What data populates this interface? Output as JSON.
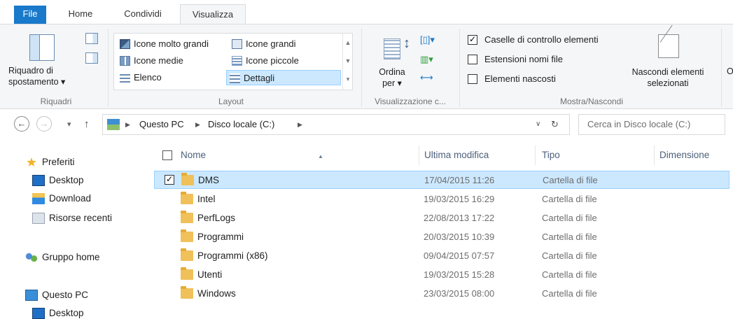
{
  "ribbon_tabs": {
    "file": "File",
    "home": "Home",
    "share": "Condividi",
    "view": "Visualizza"
  },
  "ribbon": {
    "panes": {
      "nav_pane_label_line1": "Riquadro di",
      "nav_pane_label_line2": "spostamento ▾",
      "group_label": "Riquadri"
    },
    "layout": {
      "items": [
        "Icone molto grandi",
        "Icone grandi",
        "Icone medie",
        "Icone piccole",
        "Elenco",
        "Dettagli"
      ],
      "selected": "Dettagli",
      "group_label": "Layout"
    },
    "current_view": {
      "sort_line1": "Ordina",
      "sort_line2": "per ▾",
      "group_label": "Visualizzazione c..."
    },
    "show_hide": {
      "checkboxes": [
        {
          "label": "Caselle di controllo elementi",
          "checked": true
        },
        {
          "label": "Estensioni nomi file",
          "checked": false
        },
        {
          "label": "Elementi nascosti",
          "checked": false
        }
      ],
      "hide_selected_line1": "Nascondi elementi",
      "hide_selected_line2": "selezionati",
      "group_label": "Mostra/Nascondi",
      "cutoff_text": "O"
    }
  },
  "address_bar": {
    "breadcrumbs": [
      "Questo PC",
      "Disco locale (C:)"
    ],
    "search_placeholder": "Cerca in Disco locale (C:)"
  },
  "nav_pane": {
    "favorites": "Preferiti",
    "favorites_items": [
      "Desktop",
      "Download",
      "Risorse recenti"
    ],
    "homegroup": "Gruppo home",
    "this_pc": "Questo PC",
    "this_pc_items": [
      "Desktop"
    ]
  },
  "file_list": {
    "columns": {
      "name": "Nome",
      "modified": "Ultima modifica",
      "type": "Tipo",
      "size": "Dimensione"
    },
    "rows": [
      {
        "name": "DMS",
        "modified": "17/04/2015 11:26",
        "type": "Cartella di file",
        "selected": true
      },
      {
        "name": "Intel",
        "modified": "19/03/2015 16:29",
        "type": "Cartella di file",
        "selected": false
      },
      {
        "name": "PerfLogs",
        "modified": "22/08/2013 17:22",
        "type": "Cartella di file",
        "selected": false
      },
      {
        "name": "Programmi",
        "modified": "20/03/2015 10:39",
        "type": "Cartella di file",
        "selected": false
      },
      {
        "name": "Programmi (x86)",
        "modified": "09/04/2015 07:57",
        "type": "Cartella di file",
        "selected": false
      },
      {
        "name": "Utenti",
        "modified": "19/03/2015 15:28",
        "type": "Cartella di file",
        "selected": false
      },
      {
        "name": "Windows",
        "modified": "23/03/2015 08:00",
        "type": "Cartella di file",
        "selected": false
      }
    ]
  },
  "colors": {
    "file_tab": "#1979ca",
    "selection": "#cce8ff",
    "selection_border": "#99d1ff",
    "ribbon_bg": "#f5f6f7"
  }
}
